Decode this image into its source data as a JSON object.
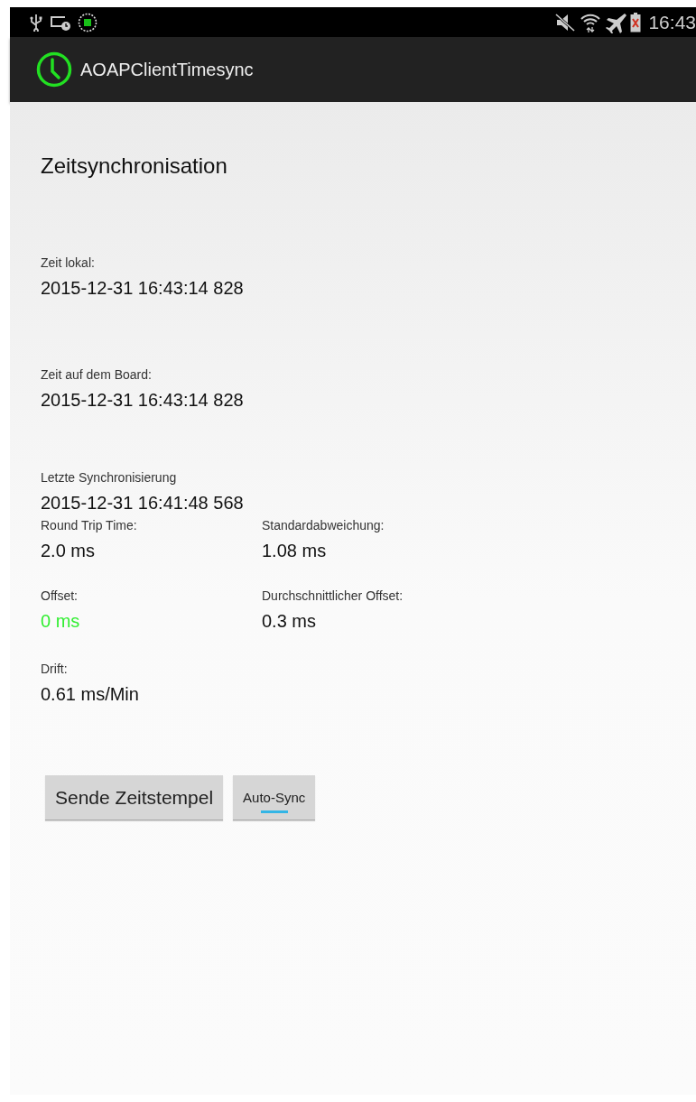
{
  "status_bar": {
    "time": "16:43"
  },
  "action_bar": {
    "title": "AOAPClientTimesync"
  },
  "heading": "Zeitsynchronisation",
  "rows": [
    {
      "items": [
        {
          "label": "Zeit lokal:",
          "value": "2015-12-31 16:43:14 828",
          "color": "#111111"
        }
      ]
    },
    {
      "items": [
        {
          "label": "Zeit auf dem Board:",
          "value": "2015-12-31 16:43:14 828",
          "color": "#111111"
        }
      ]
    },
    {
      "items": [
        {
          "label": "Letzte Synchronisierung",
          "value": "2015-12-31 16:41:48 568",
          "color": "#111111"
        }
      ]
    },
    {
      "items": [
        {
          "label": "Round Trip Time:",
          "value": "2.0 ms",
          "color": "#111111"
        },
        {
          "label": "Standardabweichung:",
          "value": "1.08 ms",
          "color": "#111111"
        }
      ]
    },
    {
      "items": [
        {
          "label": "Offset:",
          "value": "0 ms",
          "color": "#33ee33"
        },
        {
          "label": "Durchschnittlicher Offset:",
          "value": "0.3 ms",
          "color": "#111111"
        }
      ]
    },
    {
      "items": [
        {
          "label": "Drift:",
          "value": "0.61 ms/Min",
          "color": "#111111"
        }
      ]
    }
  ],
  "send_button": "Sende Zeitstempel",
  "toggle": {
    "label": "Auto-Sync",
    "on": true
  }
}
